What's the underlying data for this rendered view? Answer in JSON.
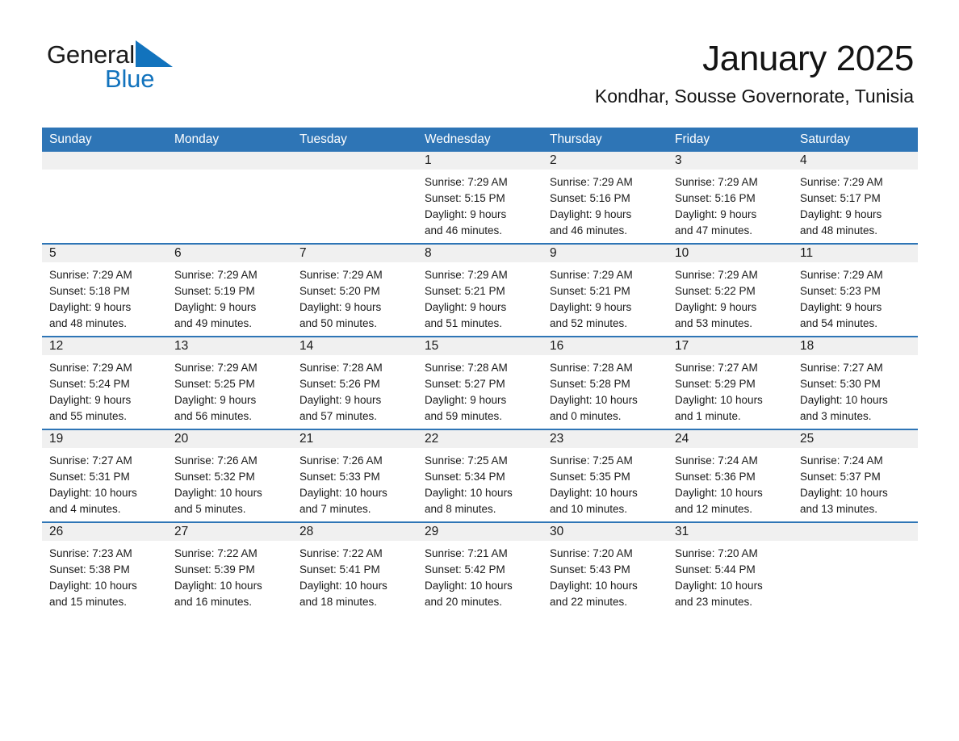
{
  "logo": {
    "word1": "General",
    "word2": "Blue",
    "triangle_color": "#1273bd",
    "text_color": "#1a1a1a"
  },
  "header": {
    "month_title": "January 2025",
    "location": "Kondhar, Sousse Governorate, Tunisia"
  },
  "theme": {
    "header_blue": "#2e75b6",
    "daynum_gray": "#f0f0f0",
    "text": "#1a1a1a",
    "white": "#ffffff"
  },
  "weekdays": [
    "Sunday",
    "Monday",
    "Tuesday",
    "Wednesday",
    "Thursday",
    "Friday",
    "Saturday"
  ],
  "weeks": [
    [
      {
        "day": "",
        "blank": true,
        "sunrise": "",
        "sunset": "",
        "daylight1": "",
        "daylight2": ""
      },
      {
        "day": "",
        "blank": true,
        "sunrise": "",
        "sunset": "",
        "daylight1": "",
        "daylight2": ""
      },
      {
        "day": "",
        "blank": true,
        "sunrise": "",
        "sunset": "",
        "daylight1": "",
        "daylight2": ""
      },
      {
        "day": "1",
        "blank": false,
        "sunrise": "Sunrise: 7:29 AM",
        "sunset": "Sunset: 5:15 PM",
        "daylight1": "Daylight: 9 hours",
        "daylight2": "and 46 minutes."
      },
      {
        "day": "2",
        "blank": false,
        "sunrise": "Sunrise: 7:29 AM",
        "sunset": "Sunset: 5:16 PM",
        "daylight1": "Daylight: 9 hours",
        "daylight2": "and 46 minutes."
      },
      {
        "day": "3",
        "blank": false,
        "sunrise": "Sunrise: 7:29 AM",
        "sunset": "Sunset: 5:16 PM",
        "daylight1": "Daylight: 9 hours",
        "daylight2": "and 47 minutes."
      },
      {
        "day": "4",
        "blank": false,
        "sunrise": "Sunrise: 7:29 AM",
        "sunset": "Sunset: 5:17 PM",
        "daylight1": "Daylight: 9 hours",
        "daylight2": "and 48 minutes."
      }
    ],
    [
      {
        "day": "5",
        "blank": false,
        "sunrise": "Sunrise: 7:29 AM",
        "sunset": "Sunset: 5:18 PM",
        "daylight1": "Daylight: 9 hours",
        "daylight2": "and 48 minutes."
      },
      {
        "day": "6",
        "blank": false,
        "sunrise": "Sunrise: 7:29 AM",
        "sunset": "Sunset: 5:19 PM",
        "daylight1": "Daylight: 9 hours",
        "daylight2": "and 49 minutes."
      },
      {
        "day": "7",
        "blank": false,
        "sunrise": "Sunrise: 7:29 AM",
        "sunset": "Sunset: 5:20 PM",
        "daylight1": "Daylight: 9 hours",
        "daylight2": "and 50 minutes."
      },
      {
        "day": "8",
        "blank": false,
        "sunrise": "Sunrise: 7:29 AM",
        "sunset": "Sunset: 5:21 PM",
        "daylight1": "Daylight: 9 hours",
        "daylight2": "and 51 minutes."
      },
      {
        "day": "9",
        "blank": false,
        "sunrise": "Sunrise: 7:29 AM",
        "sunset": "Sunset: 5:21 PM",
        "daylight1": "Daylight: 9 hours",
        "daylight2": "and 52 minutes."
      },
      {
        "day": "10",
        "blank": false,
        "sunrise": "Sunrise: 7:29 AM",
        "sunset": "Sunset: 5:22 PM",
        "daylight1": "Daylight: 9 hours",
        "daylight2": "and 53 minutes."
      },
      {
        "day": "11",
        "blank": false,
        "sunrise": "Sunrise: 7:29 AM",
        "sunset": "Sunset: 5:23 PM",
        "daylight1": "Daylight: 9 hours",
        "daylight2": "and 54 minutes."
      }
    ],
    [
      {
        "day": "12",
        "blank": false,
        "sunrise": "Sunrise: 7:29 AM",
        "sunset": "Sunset: 5:24 PM",
        "daylight1": "Daylight: 9 hours",
        "daylight2": "and 55 minutes."
      },
      {
        "day": "13",
        "blank": false,
        "sunrise": "Sunrise: 7:29 AM",
        "sunset": "Sunset: 5:25 PM",
        "daylight1": "Daylight: 9 hours",
        "daylight2": "and 56 minutes."
      },
      {
        "day": "14",
        "blank": false,
        "sunrise": "Sunrise: 7:28 AM",
        "sunset": "Sunset: 5:26 PM",
        "daylight1": "Daylight: 9 hours",
        "daylight2": "and 57 minutes."
      },
      {
        "day": "15",
        "blank": false,
        "sunrise": "Sunrise: 7:28 AM",
        "sunset": "Sunset: 5:27 PM",
        "daylight1": "Daylight: 9 hours",
        "daylight2": "and 59 minutes."
      },
      {
        "day": "16",
        "blank": false,
        "sunrise": "Sunrise: 7:28 AM",
        "sunset": "Sunset: 5:28 PM",
        "daylight1": "Daylight: 10 hours",
        "daylight2": "and 0 minutes."
      },
      {
        "day": "17",
        "blank": false,
        "sunrise": "Sunrise: 7:27 AM",
        "sunset": "Sunset: 5:29 PM",
        "daylight1": "Daylight: 10 hours",
        "daylight2": "and 1 minute."
      },
      {
        "day": "18",
        "blank": false,
        "sunrise": "Sunrise: 7:27 AM",
        "sunset": "Sunset: 5:30 PM",
        "daylight1": "Daylight: 10 hours",
        "daylight2": "and 3 minutes."
      }
    ],
    [
      {
        "day": "19",
        "blank": false,
        "sunrise": "Sunrise: 7:27 AM",
        "sunset": "Sunset: 5:31 PM",
        "daylight1": "Daylight: 10 hours",
        "daylight2": "and 4 minutes."
      },
      {
        "day": "20",
        "blank": false,
        "sunrise": "Sunrise: 7:26 AM",
        "sunset": "Sunset: 5:32 PM",
        "daylight1": "Daylight: 10 hours",
        "daylight2": "and 5 minutes."
      },
      {
        "day": "21",
        "blank": false,
        "sunrise": "Sunrise: 7:26 AM",
        "sunset": "Sunset: 5:33 PM",
        "daylight1": "Daylight: 10 hours",
        "daylight2": "and 7 minutes."
      },
      {
        "day": "22",
        "blank": false,
        "sunrise": "Sunrise: 7:25 AM",
        "sunset": "Sunset: 5:34 PM",
        "daylight1": "Daylight: 10 hours",
        "daylight2": "and 8 minutes."
      },
      {
        "day": "23",
        "blank": false,
        "sunrise": "Sunrise: 7:25 AM",
        "sunset": "Sunset: 5:35 PM",
        "daylight1": "Daylight: 10 hours",
        "daylight2": "and 10 minutes."
      },
      {
        "day": "24",
        "blank": false,
        "sunrise": "Sunrise: 7:24 AM",
        "sunset": "Sunset: 5:36 PM",
        "daylight1": "Daylight: 10 hours",
        "daylight2": "and 12 minutes."
      },
      {
        "day": "25",
        "blank": false,
        "sunrise": "Sunrise: 7:24 AM",
        "sunset": "Sunset: 5:37 PM",
        "daylight1": "Daylight: 10 hours",
        "daylight2": "and 13 minutes."
      }
    ],
    [
      {
        "day": "26",
        "blank": false,
        "sunrise": "Sunrise: 7:23 AM",
        "sunset": "Sunset: 5:38 PM",
        "daylight1": "Daylight: 10 hours",
        "daylight2": "and 15 minutes."
      },
      {
        "day": "27",
        "blank": false,
        "sunrise": "Sunrise: 7:22 AM",
        "sunset": "Sunset: 5:39 PM",
        "daylight1": "Daylight: 10 hours",
        "daylight2": "and 16 minutes."
      },
      {
        "day": "28",
        "blank": false,
        "sunrise": "Sunrise: 7:22 AM",
        "sunset": "Sunset: 5:41 PM",
        "daylight1": "Daylight: 10 hours",
        "daylight2": "and 18 minutes."
      },
      {
        "day": "29",
        "blank": false,
        "sunrise": "Sunrise: 7:21 AM",
        "sunset": "Sunset: 5:42 PM",
        "daylight1": "Daylight: 10 hours",
        "daylight2": "and 20 minutes."
      },
      {
        "day": "30",
        "blank": false,
        "sunrise": "Sunrise: 7:20 AM",
        "sunset": "Sunset: 5:43 PM",
        "daylight1": "Daylight: 10 hours",
        "daylight2": "and 22 minutes."
      },
      {
        "day": "31",
        "blank": false,
        "sunrise": "Sunrise: 7:20 AM",
        "sunset": "Sunset: 5:44 PM",
        "daylight1": "Daylight: 10 hours",
        "daylight2": "and 23 minutes."
      },
      {
        "day": "",
        "blank": true,
        "sunrise": "",
        "sunset": "",
        "daylight1": "",
        "daylight2": ""
      }
    ]
  ]
}
